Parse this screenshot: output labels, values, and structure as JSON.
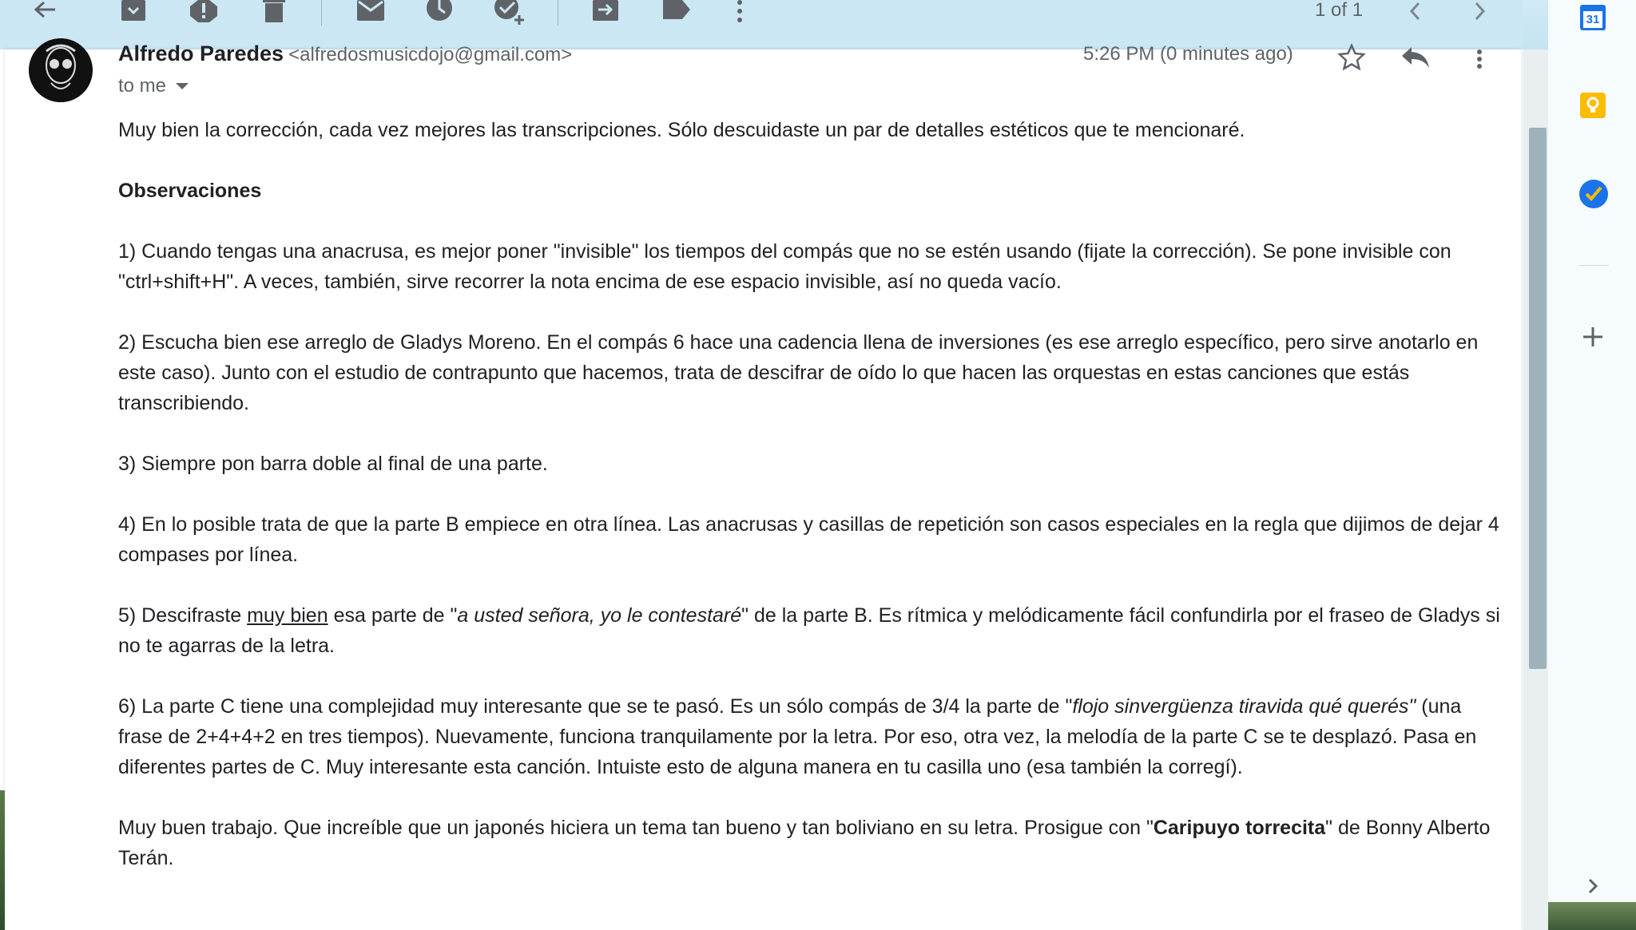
{
  "toolbar": {
    "page_count": "1 of 1",
    "icons": [
      "back-arrow-icon",
      "archive-icon",
      "report-spam-icon",
      "delete-icon",
      "mark-unread-icon",
      "snooze-icon",
      "add-to-tasks-icon",
      "move-to-icon",
      "label-icon",
      "more-vert-icon",
      "chevron-left-icon",
      "chevron-right-icon"
    ]
  },
  "email": {
    "sender_name": "Alfredo Paredes",
    "sender_email": "<alfredosmusicdojo@gmail.com>",
    "recipient": "to me",
    "timestamp": "5:26 PM (0 minutes ago)",
    "body": {
      "intro": "Muy bien la corrección, cada vez mejores las transcripciones. Sólo descuidaste un par de detalles estéticos que te mencionaré.",
      "heading": "Observaciones",
      "p1": "1) Cuando tengas una anacrusa, es mejor poner \"invisible\" los tiempos del compás que no se estén usando (fijate la corrección). Se pone invisible con \"ctrl+shift+H\". A veces, también, sirve recorrer la nota encima de ese espacio invisible, así no queda vacío.",
      "p2": "2) Escucha bien ese arreglo de Gladys Moreno. En el compás 6 hace una cadencia llena de inversiones (es ese arreglo específico, pero sirve anotarlo en este caso). Junto con el estudio de contrapunto que hacemos, trata de descifrar de oído lo que hacen las orquestas en estas canciones que estás transcribiendo.",
      "p3": "3) Siempre pon barra doble al final de una parte.",
      "p4": "4) En lo posible trata de que la parte B empiece en otra línea. Las anacrusas y casillas de repetición son casos especiales en la regla que dijimos de dejar 4 compases por línea.",
      "p5_a": "5)  Descifraste ",
      "p5_u": "muy bien",
      "p5_b": " esa parte de \"",
      "p5_i": "a usted señora, yo le contestaré",
      "p5_c": "\" de la parte B. Es rítmica y melódicamente fácil confundirla por el fraseo de Gladys si no te agarras de la letra.",
      "p6_a": "6) La parte C tiene una complejidad muy interesante que se te pasó. Es un sólo compás de 3/4 la parte de \"",
      "p6_i": "flojo sinvergüenza tiravida qué querés\"",
      "p6_b": " (una frase de 2+4+4+2 en tres tiempos). Nuevamente, funciona tranquilamente por la letra. Por eso, otra vez, la melodía de la parte C se te desplazó. Pasa en diferentes partes de C. Muy interesante esta canción. Intuiste esto de alguna manera en tu casilla uno (esa también la corregí).",
      "p7_a": "Muy buen trabajo. Que increíble que un japonés hiciera un tema tan bueno y tan boliviano en su letra. Prosigue con \"",
      "p7_b": "Caripuyo torrecita",
      "p7_c": "\" de Bonny Alberto Terán."
    }
  },
  "side_panel": {
    "calendar_day": "31"
  },
  "colors": {
    "toolbar_bg": "#cbe7f4",
    "text": "#202124",
    "muted": "#5f6368",
    "calendar_blue": "#1a73e8",
    "keep_yellow": "#fbbc04"
  }
}
